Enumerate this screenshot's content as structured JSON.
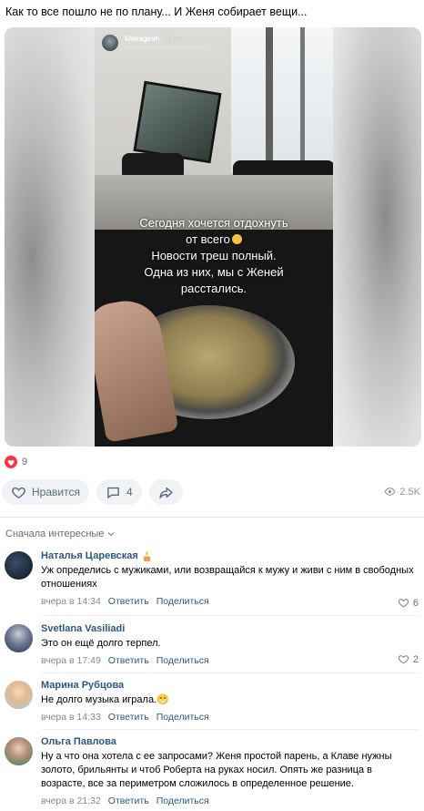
{
  "post": {
    "text": "Как то все пошло не по плану... И Женя собирает вещи..."
  },
  "story": {
    "username": "klavagesh",
    "time": "13 мин.",
    "subline": "Бумеранг: автор: instagram. li",
    "caption_lines": [
      "Сегодня хочется отдохнуть",
      "от всего",
      "Новости треш полный.",
      "Одна из них, мы с Женей",
      "расстались."
    ],
    "menu_icon": "more-vertical-icon"
  },
  "reactions": {
    "likes_count": "9",
    "like_color": "#ff3347"
  },
  "actions": {
    "like_label": "Нравится",
    "comments_count": "4",
    "views_count": "2.5K"
  },
  "comments_section": {
    "sort_label": "Сначала интересные"
  },
  "comments": [
    {
      "author": "Наталья Царевская",
      "text": "Уж определись с мужиками, или возвращайся к мужу и живи с ним в свободных отношениях",
      "time": "вчера в 14:34",
      "reply_label": "Ответить",
      "share_label": "Поделиться",
      "likes": "6"
    },
    {
      "author": "Svetlana Vasiliadi",
      "text": "Это он ещё долго терпел.",
      "time": "вчера в 17:49",
      "reply_label": "Ответить",
      "share_label": "Поделиться",
      "likes": "2"
    },
    {
      "author": "Марина Рубцова",
      "text": "Не долго музыка играла.😁",
      "time": "вчера в 14:33",
      "reply_label": "Ответить",
      "share_label": "Поделиться",
      "likes": ""
    },
    {
      "author": "Ольга Павлова",
      "text": "Ну а что она хотела с ее запросами? Женя простой парень, а Клаве нужны золото, брильянты и чтоб Роберта на руках носил. Опять же разница в возрасте, все за периметром сложилось в определенное решение.",
      "time": "вчера в 21:32",
      "reply_label": "Ответить",
      "share_label": "Поделиться",
      "likes": ""
    }
  ],
  "colors": {
    "link": "#2a5885",
    "muted": "#828a99",
    "pill_bg": "#f0f2f5"
  }
}
